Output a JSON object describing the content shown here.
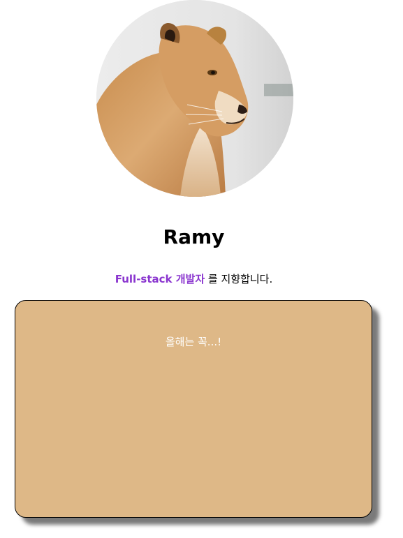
{
  "profile": {
    "name": "Ramy",
    "role_highlight": "Full-stack 개발자",
    "role_suffix": " 를 지향합니다.",
    "avatar_icon": "lioness-photo"
  },
  "card": {
    "message": "올해는 꼭...!",
    "background_color": "#deb887"
  },
  "colors": {
    "highlight": "#8a35cf"
  }
}
